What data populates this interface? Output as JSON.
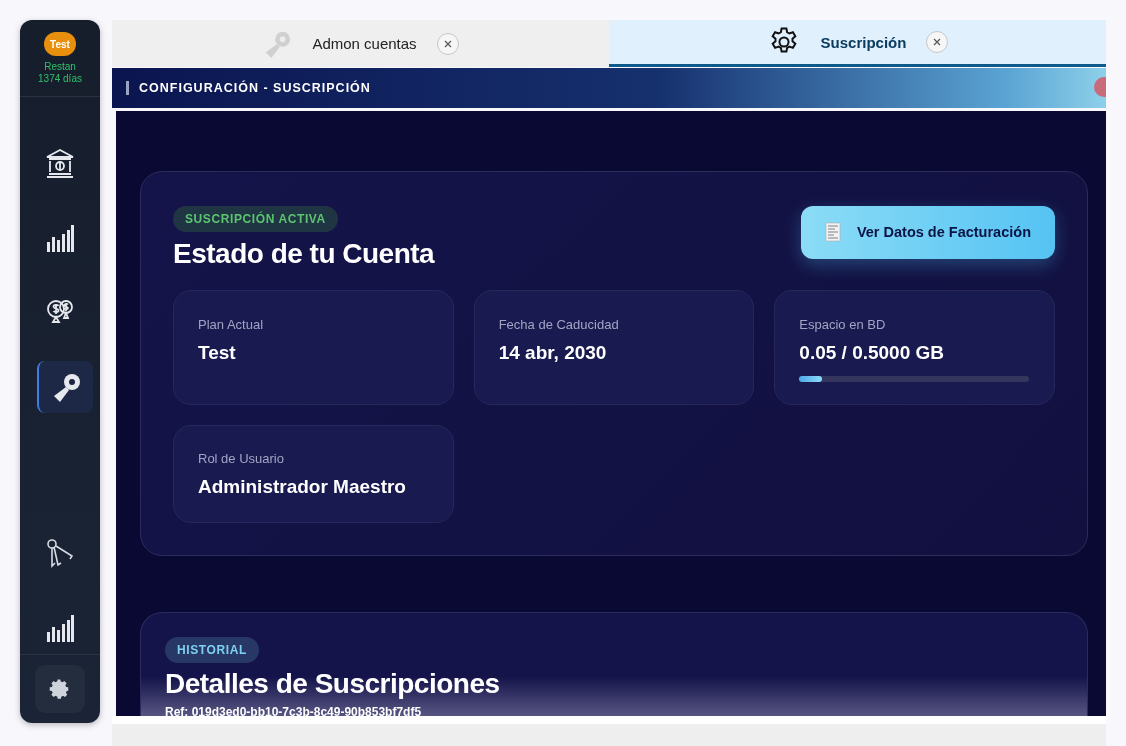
{
  "sidebar": {
    "badge": "Test",
    "remaining": "Restan\n1374 días",
    "items": [
      {
        "kind": "bank",
        "selected": false
      },
      {
        "kind": "bars",
        "selected": false
      },
      {
        "kind": "pins",
        "selected": false
      },
      {
        "kind": "wrench",
        "selected": true
      },
      {
        "kind": "keys",
        "selected": false
      },
      {
        "kind": "bars",
        "selected": false
      }
    ]
  },
  "tabs": [
    {
      "label": "Admon cuentas",
      "kind": "wrench",
      "selected": false
    },
    {
      "label": "Suscripción",
      "kind": "gear",
      "selected": true
    }
  ],
  "header": {
    "title": "CONFIGURACIÓN - SUSCRIPCIÓN"
  },
  "account": {
    "badge": "SUSCRIPCIÓN ACTIVA",
    "title": "Estado de tu Cuenta",
    "button": "Ver Datos de Facturación",
    "stats": [
      {
        "kind": "plain",
        "label": "Plan Actual",
        "value": "Test"
      },
      {
        "kind": "plain",
        "label": "Fecha de Caducidad",
        "value": "14 abr, 2030"
      },
      {
        "kind": "progress",
        "label": "Espacio en BD",
        "value": "0.05 / 0.5000 GB",
        "level": 0.1
      },
      {
        "kind": "plain",
        "label": "Rol de Usuario",
        "value": "Administrador Maestro"
      }
    ]
  },
  "history": {
    "badge": "HISTORIAL",
    "title": "Detalles de Suscripciones",
    "ref": "Ref: 019d3ed0-bb10-7c3b-8c49-90b853bf7df5"
  }
}
